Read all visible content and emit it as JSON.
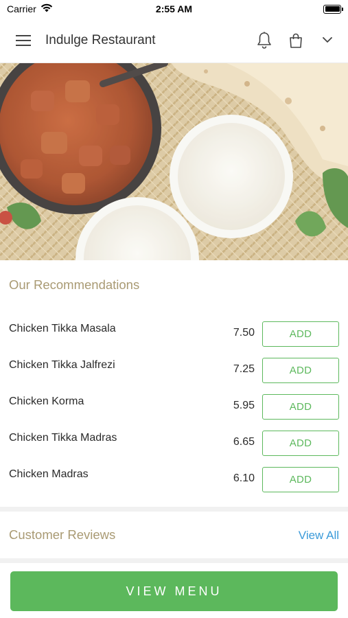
{
  "status_bar": {
    "carrier": "Carrier",
    "time": "2:55 AM",
    "battery_level": 1.0
  },
  "header": {
    "title": "Indulge Restaurant",
    "icons": [
      "hamburger-menu-icon",
      "bell-icon",
      "shopping-bag-icon",
      "chevron-down-icon"
    ]
  },
  "hero": {
    "image": "curry dishes with rice and naan"
  },
  "recommendations": {
    "title": "Our Recommendations",
    "items": [
      {
        "name": "Chicken Tikka Masala",
        "price": "7.50",
        "button": "ADD"
      },
      {
        "name": "Chicken Tikka Jalfrezi",
        "price": "7.25",
        "button": "ADD"
      },
      {
        "name": "Chicken Korma",
        "price": "5.95",
        "button": "ADD"
      },
      {
        "name": "Chicken Tikka Madras",
        "price": "6.65",
        "button": "ADD"
      },
      {
        "name": "Chicken Madras",
        "price": "6.10",
        "button": "ADD"
      }
    ]
  },
  "reviews": {
    "title": "Customer Reviews",
    "view_all": "View All"
  },
  "footer": {
    "view_menu": "VIEW MENU"
  },
  "colors": {
    "accent_green": "#5cb85c",
    "section_title": "#a99a73",
    "link_blue": "#3a9ad9"
  }
}
